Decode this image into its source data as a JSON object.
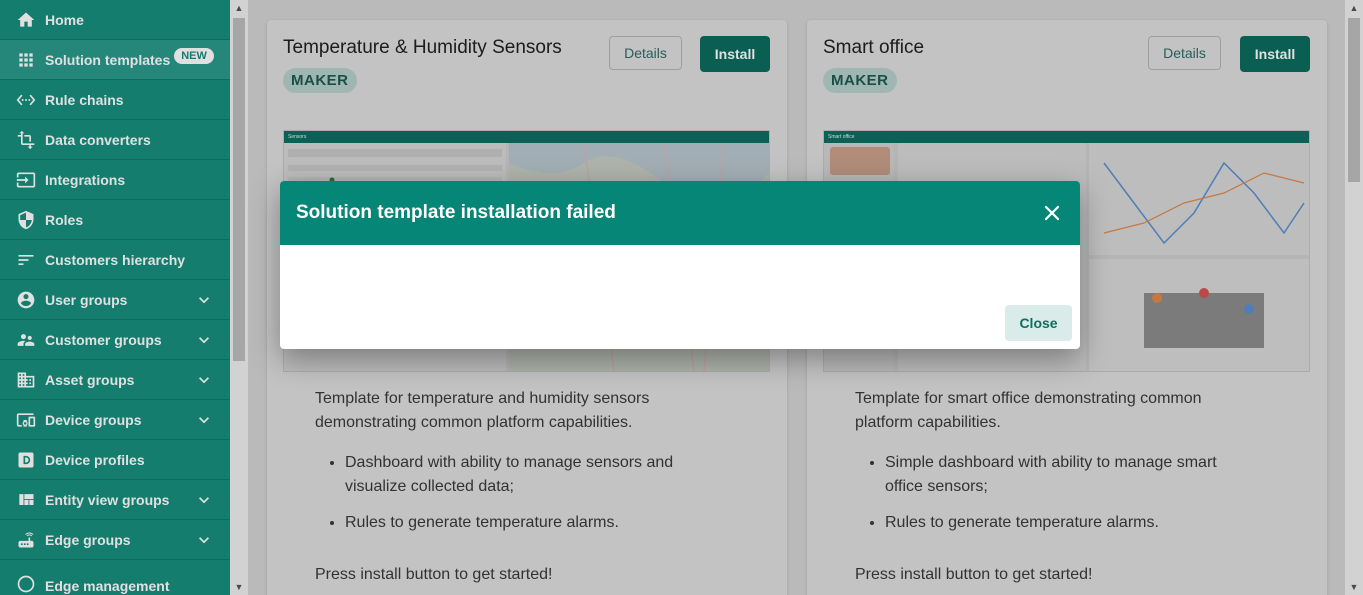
{
  "sidebar": {
    "items": [
      {
        "label": "Home",
        "icon": "home-icon"
      },
      {
        "label": "Solution templates",
        "icon": "apps-grid-icon",
        "badge": "NEW"
      },
      {
        "label": "Rule chains",
        "icon": "settings-ethernet-icon"
      },
      {
        "label": "Data converters",
        "icon": "transform-icon"
      },
      {
        "label": "Integrations",
        "icon": "input-icon"
      },
      {
        "label": "Roles",
        "icon": "security-shield-icon"
      },
      {
        "label": "Customers hierarchy",
        "icon": "sort-icon"
      },
      {
        "label": "User groups",
        "icon": "account-circle-icon"
      },
      {
        "label": "Customer groups",
        "icon": "supervisor-account-icon"
      },
      {
        "label": "Asset groups",
        "icon": "domain-icon"
      },
      {
        "label": "Device groups",
        "icon": "devices-other-icon"
      },
      {
        "label": "Device profiles",
        "icon": "device-profile-icon"
      },
      {
        "label": "Entity view groups",
        "icon": "view-quilt-icon"
      },
      {
        "label": "Edge groups",
        "icon": "router-icon"
      },
      {
        "label": "Edge management",
        "icon": "edge-management-icon"
      }
    ]
  },
  "cards": [
    {
      "title": "Temperature & Humidity Sensors",
      "tag": "MAKER",
      "details_label": "Details",
      "install_label": "Install",
      "preview_header": "Sensors",
      "description": "Template for temperature and humidity sensors demonstrating common platform capabilities.",
      "bullets": [
        "Dashboard with ability to manage sensors and visualize collected data;",
        "Rules to generate temperature alarms."
      ],
      "footer": "Press install button to get started!"
    },
    {
      "title": "Smart office",
      "tag": "MAKER",
      "details_label": "Details",
      "install_label": "Install",
      "preview_header": "Smart office",
      "description": "Template for smart office demonstrating common platform capabilities.",
      "bullets": [
        "Simple dashboard with ability to manage smart office sensors;",
        "Rules to generate temperature alarms."
      ],
      "footer": "Press install button to get started!"
    }
  ],
  "dialog": {
    "title": "Solution template installation failed",
    "close_label": "Close"
  },
  "colors": {
    "primary": "#068677",
    "sidebar": "#178f7e",
    "install": "#0d6b5e"
  }
}
